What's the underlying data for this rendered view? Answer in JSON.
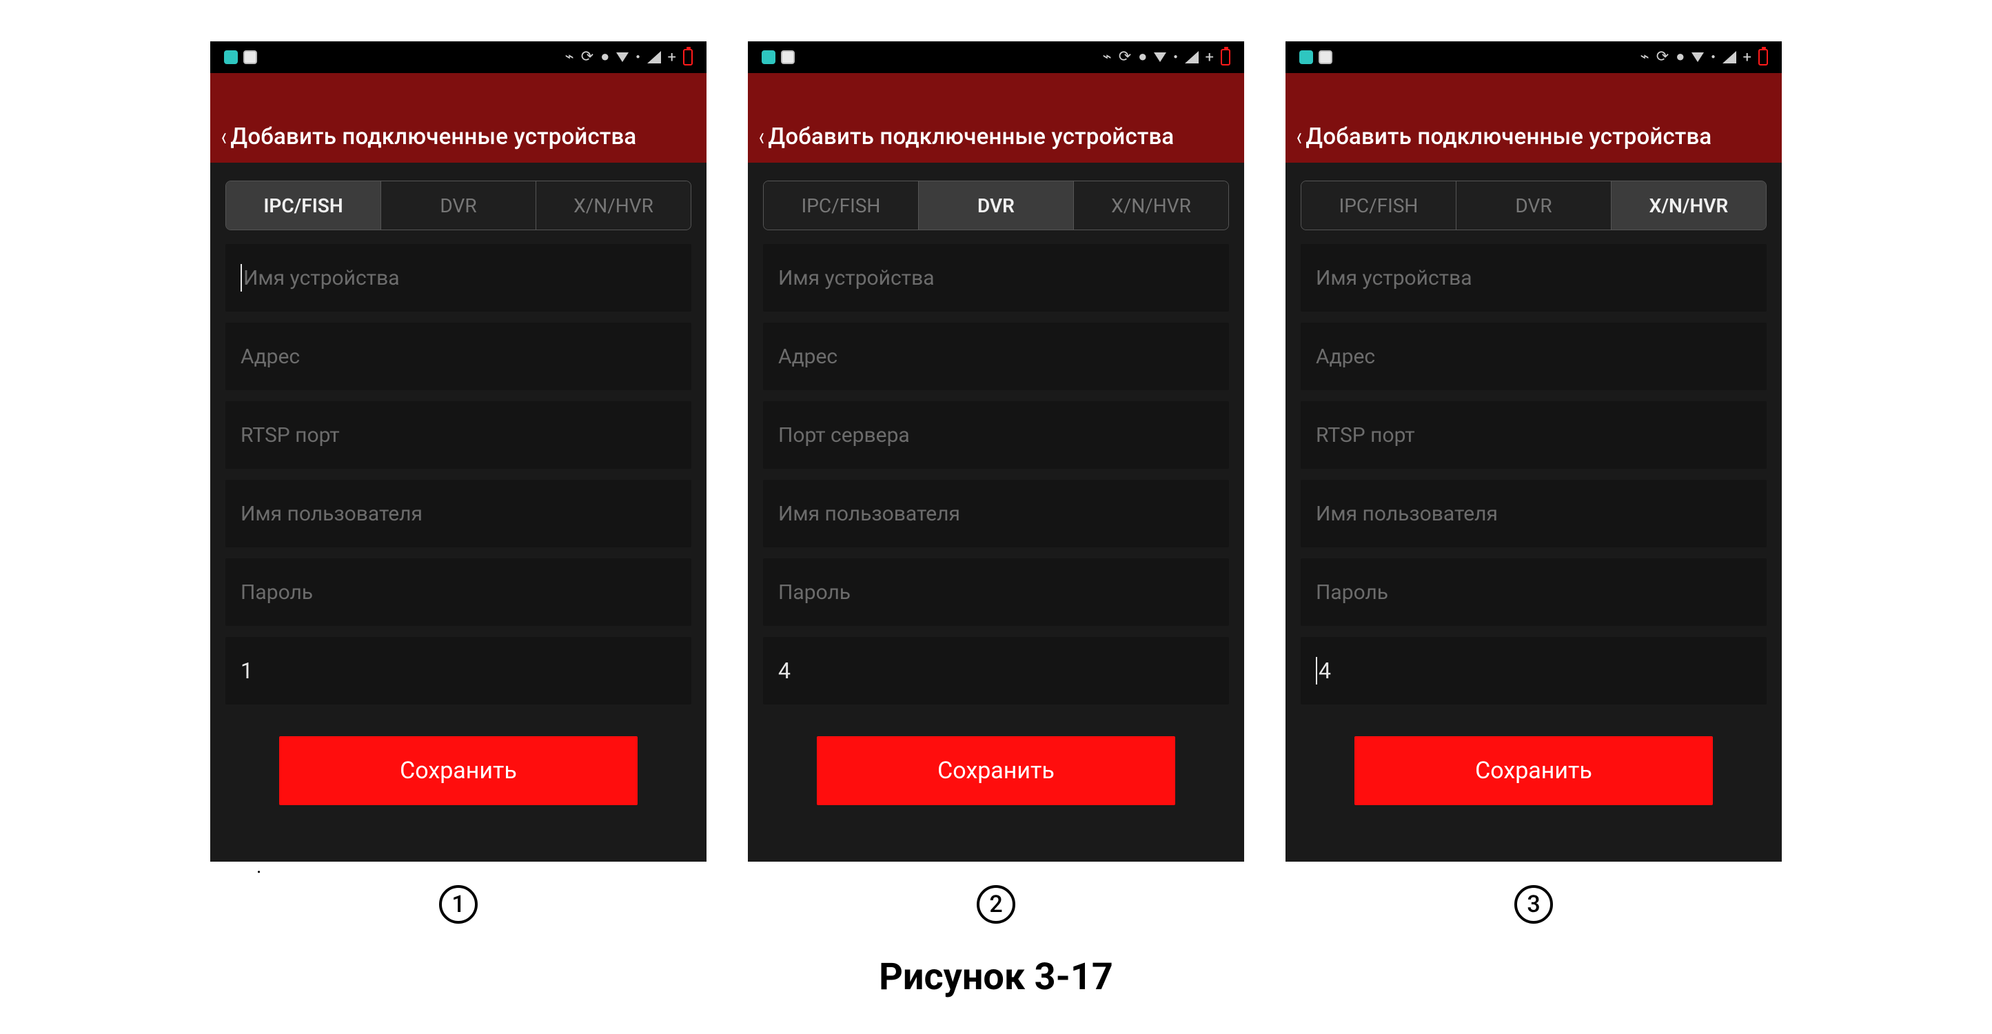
{
  "caption": "Рисунок 3-17",
  "screens": [
    {
      "number_label": "1",
      "header_title": "Добавить подключенные устройства",
      "tabs": [
        "IPC/FISH",
        "DVR",
        "X/N/HVR"
      ],
      "active_tab_index": 0,
      "fields": [
        {
          "placeholder": "Имя устройства",
          "value": "",
          "show_cursor": true
        },
        {
          "placeholder": "Адрес",
          "value": ""
        },
        {
          "placeholder": "RTSP порт",
          "value": ""
        },
        {
          "placeholder": "Имя пользователя",
          "value": ""
        },
        {
          "placeholder": "Пароль",
          "value": ""
        },
        {
          "placeholder": "",
          "value": "1"
        }
      ],
      "save_label": "Сохранить"
    },
    {
      "number_label": "2",
      "header_title": "Добавить подключенные устройства",
      "tabs": [
        "IPC/FISH",
        "DVR",
        "X/N/HVR"
      ],
      "active_tab_index": 1,
      "fields": [
        {
          "placeholder": "Имя устройства",
          "value": ""
        },
        {
          "placeholder": "Адрес",
          "value": ""
        },
        {
          "placeholder": "Порт сервера",
          "value": ""
        },
        {
          "placeholder": "Имя пользователя",
          "value": ""
        },
        {
          "placeholder": "Пароль",
          "value": ""
        },
        {
          "placeholder": "",
          "value": "4"
        }
      ],
      "save_label": "Сохранить"
    },
    {
      "number_label": "3",
      "header_title": "Добавить подключенные устройства",
      "tabs": [
        "IPC/FISH",
        "DVR",
        "X/N/HVR"
      ],
      "active_tab_index": 2,
      "fields": [
        {
          "placeholder": "Имя устройства",
          "value": ""
        },
        {
          "placeholder": "Адрес",
          "value": ""
        },
        {
          "placeholder": "RTSP порт",
          "value": ""
        },
        {
          "placeholder": "Имя пользователя",
          "value": ""
        },
        {
          "placeholder": "Пароль",
          "value": ""
        },
        {
          "placeholder": "",
          "value": "4",
          "show_cursor": true
        }
      ],
      "save_label": "Сохранить"
    }
  ]
}
